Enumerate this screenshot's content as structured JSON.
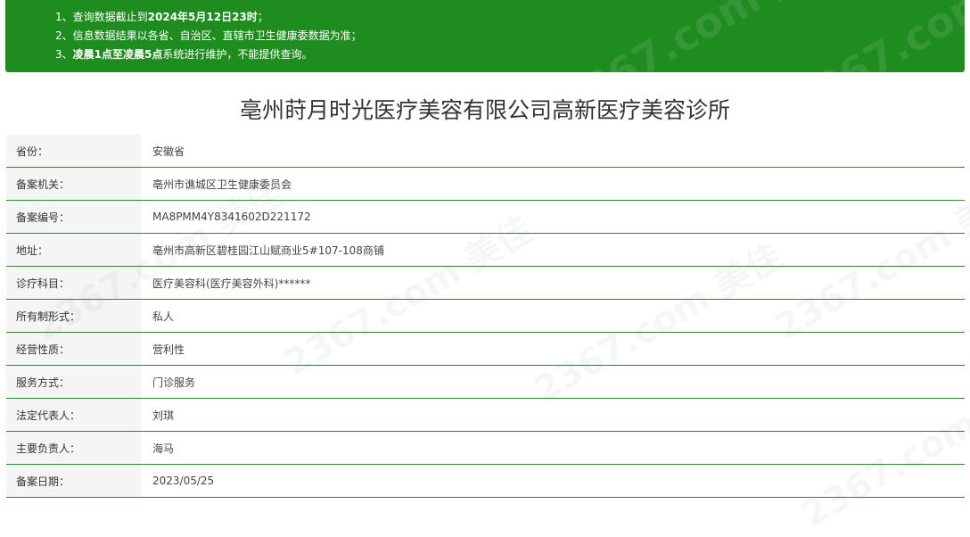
{
  "notice": {
    "line1_prefix": "1、查询数据截止到",
    "line1_bold": "2024年5月12日23时",
    "line1_suffix": "；",
    "line2": "2、信息数据结果以各省、自治区、直辖市卫生健康委数据为准；",
    "line3_prefix": "3、",
    "line3_bold": "凌晨1点至凌晨5点",
    "line3_suffix": "系统进行维护，不能提供查询。"
  },
  "title": "亳州莳月时光医疗美容有限公司高新医疗美容诊所",
  "rows": [
    {
      "key": "省份：",
      "value": "安徽省"
    },
    {
      "key": "备案机关：",
      "value": "亳州市谯城区卫生健康委员会"
    },
    {
      "key": "备案编号：",
      "value": "MA8PMM4Y8341602D221172"
    },
    {
      "key": "地址：",
      "value": "亳州市高新区碧桂园江山赋商业5#107-108商铺"
    },
    {
      "key": "诊疗科目：",
      "value": "医疗美容科(医疗美容外科)******"
    },
    {
      "key": "所有制形式：",
      "value": "私人"
    },
    {
      "key": "经营性质：",
      "value": "营利性"
    },
    {
      "key": "服务方式：",
      "value": "门诊服务"
    },
    {
      "key": "法定代表人：",
      "value": "刘琪"
    },
    {
      "key": "主要负责人：",
      "value": "海马"
    },
    {
      "key": "备案日期：",
      "value": "2023/05/25"
    }
  ],
  "watermark": "2367.com 美佳"
}
